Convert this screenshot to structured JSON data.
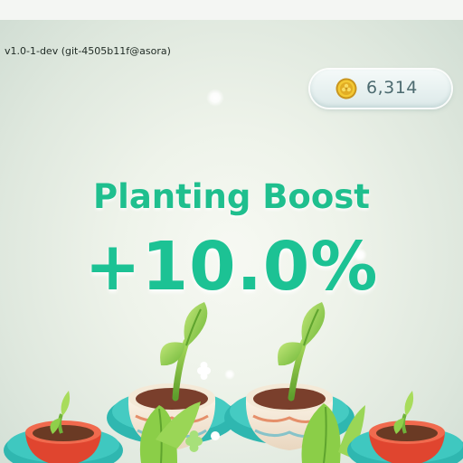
{
  "version": "v1.0-1-dev (git-4505b11f@asora)",
  "currency": {
    "icon": "gold-coin-icon",
    "amount": "6,314"
  },
  "boost": {
    "title": "Planting Boost",
    "value": "+10.0%"
  },
  "colors": {
    "accent_green": "#1fbf8e",
    "coin_text": "#4d6b70",
    "pot_red": "#e0452f",
    "pot_saucer": "#2fb7b0",
    "leaf_green": "#8fcf4a"
  },
  "scene": {
    "sprouts": [
      {
        "name": "seedling-red-pot-left"
      },
      {
        "name": "sapling-patterned-pot-center-left"
      },
      {
        "name": "sapling-patterned-pot-center-right"
      },
      {
        "name": "seedling-red-pot-right"
      }
    ]
  }
}
